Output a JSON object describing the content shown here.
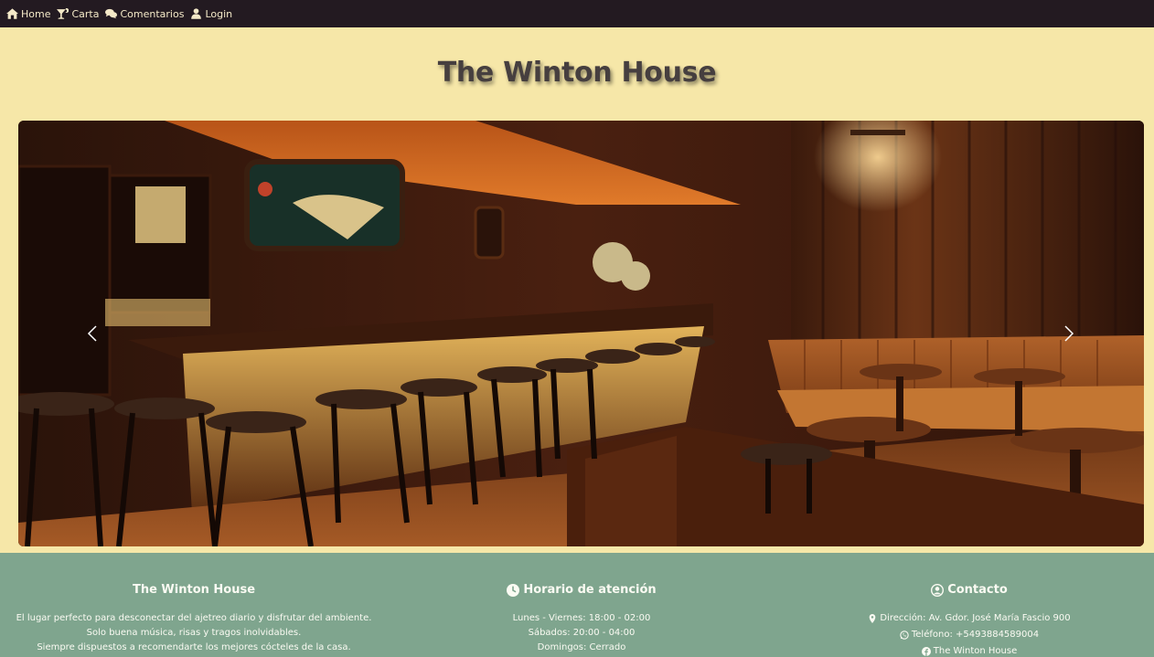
{
  "nav": {
    "items": [
      {
        "label": "Home",
        "icon": "home-icon"
      },
      {
        "label": "Carta",
        "icon": "cocktail-icon"
      },
      {
        "label": "Comentarios",
        "icon": "comments-icon"
      },
      {
        "label": "Login",
        "icon": "user-icon"
      }
    ]
  },
  "page": {
    "title": "The Winton House"
  },
  "carousel": {
    "image_alt": "Bar interior with wooden walls and stools",
    "prev_icon": "chevron-left-icon",
    "next_icon": "chevron-right-icon"
  },
  "footer": {
    "about": {
      "title": "The Winton House",
      "lines": [
        "El lugar perfecto para desconectar del ajetreo diario y disfrutar del ambiente.",
        "Solo buena música, risas y tragos inolvidables.",
        "Siempre dispuestos a recomendarte los mejores cócteles de la casa."
      ]
    },
    "hours": {
      "title": "Horario de atención",
      "icon": "clock-icon",
      "lines": [
        "Lunes - Viernes: 18:00 - 02:00",
        "Sábados: 20:00 - 04:00",
        "Domingos: Cerrado"
      ]
    },
    "contact": {
      "title": "Contacto",
      "icon": "user-circle-icon",
      "address": "Dirección: Av. Gdor. José María Fascio 900",
      "phone": "Teléfono: +5493884589004",
      "facebook": "The Winton House"
    }
  },
  "colors": {
    "navbar_bg": "#231a21",
    "page_bg": "#f6e7a8",
    "footer_bg": "#7fa58e",
    "title_color": "#463f3f"
  }
}
